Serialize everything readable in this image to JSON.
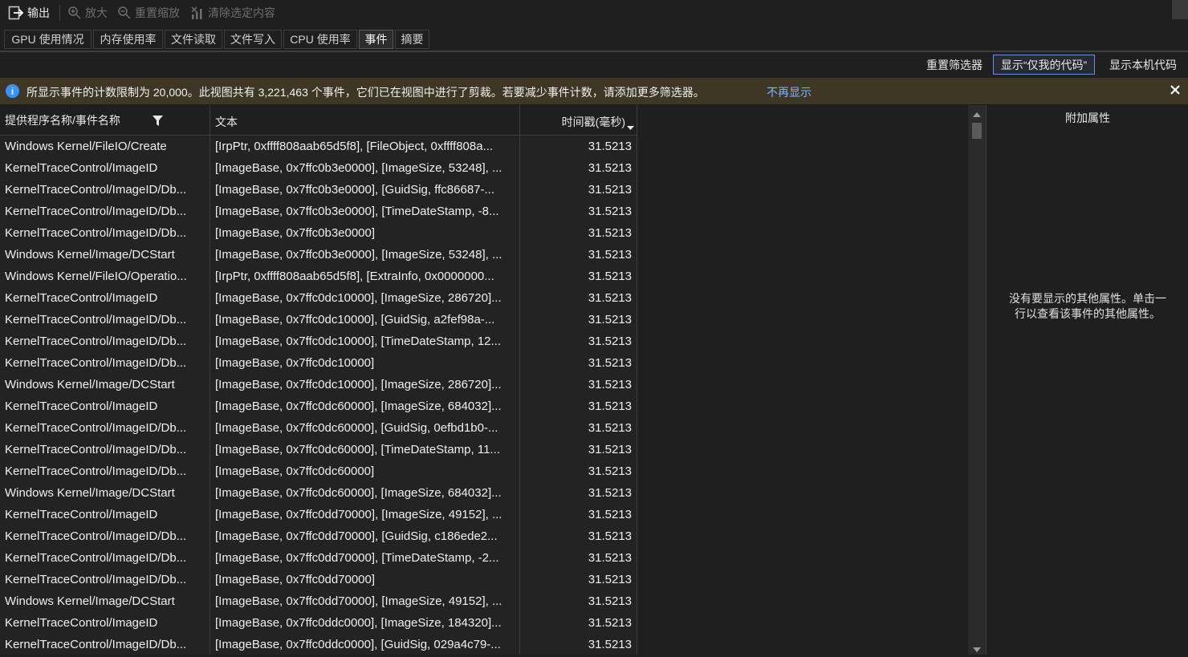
{
  "toolbar": {
    "output": "输出",
    "zoom_in": "放大",
    "reset_zoom": "重置缩放",
    "clear_selection": "清除选定内容"
  },
  "tabs": [
    {
      "label": "GPU 使用情况",
      "active": false
    },
    {
      "label": "内存使用率",
      "active": false
    },
    {
      "label": "文件读取",
      "active": false
    },
    {
      "label": "文件写入",
      "active": false
    },
    {
      "label": "CPU 使用率",
      "active": false
    },
    {
      "label": "事件",
      "active": true
    },
    {
      "label": "摘要",
      "active": false
    }
  ],
  "filters": {
    "reset": "重置筛选器",
    "just_my_code": "显示“仅我的代码”",
    "native_code": "显示本机代码"
  },
  "infobar": {
    "message": "所显示事件的计数限制为 20,000。此视图共有 3,221,463 个事件，它们已在视图中进行了剪裁。若要减少事件计数，请添加更多筛选器。",
    "link": "不再显示",
    "icon": "info-icon"
  },
  "grid": {
    "columns": [
      "提供程序名称/事件名称",
      "文本",
      "时间戳(毫秒)"
    ],
    "rows": [
      [
        "Windows Kernel/FileIO/Create",
        "[IrpPtr, 0xffff808aab65d5f8], [FileObject, 0xffff808a...",
        "31.5213"
      ],
      [
        "KernelTraceControl/ImageID",
        "[ImageBase, 0x7ffc0b3e0000], [ImageSize, 53248], ...",
        "31.5213"
      ],
      [
        "KernelTraceControl/ImageID/Db...",
        "[ImageBase, 0x7ffc0b3e0000], [GuidSig, ffc86687-...",
        "31.5213"
      ],
      [
        "KernelTraceControl/ImageID/Db...",
        "[ImageBase, 0x7ffc0b3e0000], [TimeDateStamp, -8...",
        "31.5213"
      ],
      [
        "KernelTraceControl/ImageID/Db...",
        "[ImageBase, 0x7ffc0b3e0000]",
        "31.5213"
      ],
      [
        "Windows Kernel/Image/DCStart",
        "[ImageBase, 0x7ffc0b3e0000], [ImageSize, 53248], ...",
        "31.5213"
      ],
      [
        "Windows Kernel/FileIO/Operatio...",
        "[IrpPtr, 0xffff808aab65d5f8], [ExtraInfo, 0x0000000...",
        "31.5213"
      ],
      [
        "KernelTraceControl/ImageID",
        "[ImageBase, 0x7ffc0dc10000], [ImageSize, 286720]...",
        "31.5213"
      ],
      [
        "KernelTraceControl/ImageID/Db...",
        "[ImageBase, 0x7ffc0dc10000], [GuidSig, a2fef98a-...",
        "31.5213"
      ],
      [
        "KernelTraceControl/ImageID/Db...",
        "[ImageBase, 0x7ffc0dc10000], [TimeDateStamp, 12...",
        "31.5213"
      ],
      [
        "KernelTraceControl/ImageID/Db...",
        "[ImageBase, 0x7ffc0dc10000]",
        "31.5213"
      ],
      [
        "Windows Kernel/Image/DCStart",
        "[ImageBase, 0x7ffc0dc10000], [ImageSize, 286720]...",
        "31.5213"
      ],
      [
        "KernelTraceControl/ImageID",
        "[ImageBase, 0x7ffc0dc60000], [ImageSize, 684032]...",
        "31.5213"
      ],
      [
        "KernelTraceControl/ImageID/Db...",
        "[ImageBase, 0x7ffc0dc60000], [GuidSig, 0efbd1b0-...",
        "31.5213"
      ],
      [
        "KernelTraceControl/ImageID/Db...",
        "[ImageBase, 0x7ffc0dc60000], [TimeDateStamp, 11...",
        "31.5213"
      ],
      [
        "KernelTraceControl/ImageID/Db...",
        "[ImageBase, 0x7ffc0dc60000]",
        "31.5213"
      ],
      [
        "Windows Kernel/Image/DCStart",
        "[ImageBase, 0x7ffc0dc60000], [ImageSize, 684032]...",
        "31.5213"
      ],
      [
        "KernelTraceControl/ImageID",
        "[ImageBase, 0x7ffc0dd70000], [ImageSize, 49152], ...",
        "31.5213"
      ],
      [
        "KernelTraceControl/ImageID/Db...",
        "[ImageBase, 0x7ffc0dd70000], [GuidSig, c186ede2...",
        "31.5213"
      ],
      [
        "KernelTraceControl/ImageID/Db...",
        "[ImageBase, 0x7ffc0dd70000], [TimeDateStamp, -2...",
        "31.5213"
      ],
      [
        "KernelTraceControl/ImageID/Db...",
        "[ImageBase, 0x7ffc0dd70000]",
        "31.5213"
      ],
      [
        "Windows Kernel/Image/DCStart",
        "[ImageBase, 0x7ffc0dd70000], [ImageSize, 49152], ...",
        "31.5213"
      ],
      [
        "KernelTraceControl/ImageID",
        "[ImageBase, 0x7ffc0ddc0000], [ImageSize, 184320]...",
        "31.5213"
      ],
      [
        "KernelTraceControl/ImageID/Db...",
        "[ImageBase, 0x7ffc0ddc0000], [GuidSig, 029a4c79-...",
        "31.5213"
      ]
    ]
  },
  "panel": {
    "title": "附加属性",
    "empty_message": "没有要显示的其他属性。单击一行以查看该事件的其他属性。"
  },
  "colors": {
    "background": "#1f1f1f",
    "infobar": "#3e3726",
    "link": "#7bb3ff",
    "info_blue": "#3794ff"
  }
}
